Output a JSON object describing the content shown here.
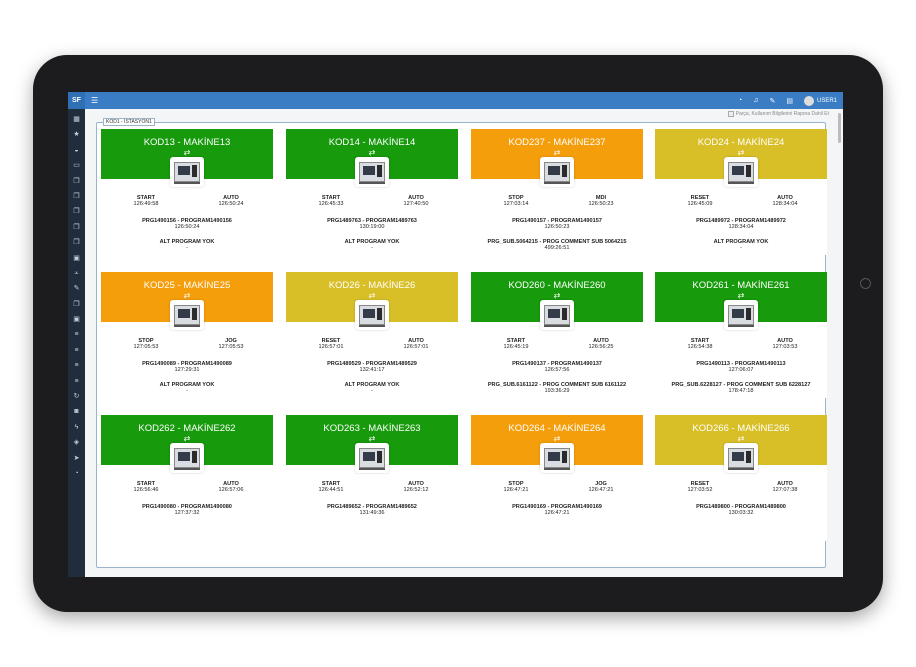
{
  "app": {
    "brand": "SF",
    "user": "USER1",
    "station_label": "KOD1 - İSTASYON1",
    "info_text": "Parça, Kullanım Bilgilerini Rapora Dahil Et"
  },
  "icons": {
    "menu": "hamburger-icon",
    "chat": "chat-icon",
    "bell": "bell-icon",
    "wrench": "wrench-icon",
    "file": "file-icon"
  },
  "colors": {
    "green": "#179a0c",
    "orange": "#f59e0b",
    "yellow": "#d8bf27",
    "topbar": "#3a7dc5",
    "sidebar": "#1f2d3d"
  },
  "cards": [
    {
      "title": "KOD13 - MAKİNE13",
      "color": "green",
      "arrow": "⇄",
      "s1": "START",
      "t1": "126:49:58",
      "s2": "AUTO",
      "t2": "126:50:24",
      "prg": "PRG1490156 - PROGRAM1490156",
      "prg_time": "126:50:24",
      "alt": "ALT PROGRAM YOK",
      "alt_time": "-"
    },
    {
      "title": "KOD14 - MAKİNE14",
      "color": "green",
      "arrow": "⇄",
      "s1": "START",
      "t1": "126:45:33",
      "s2": "AUTO",
      "t2": "127:40:50",
      "prg": "PRG1489763 - PROGRAM1489763",
      "prg_time": "130:19:00",
      "alt": "ALT PROGRAM YOK",
      "alt_time": "-"
    },
    {
      "title": "KOD237 - MAKİNE237",
      "color": "orange",
      "arrow": "⇄",
      "s1": "STOP",
      "t1": "127:03:14",
      "s2": "MDI",
      "t2": "126:50:23",
      "prg": "PRG1490157 - PROGRAM1490157",
      "prg_time": "126:50:23",
      "alt": "PRG_SUB.5064215 - PROG COMMENT SUB 5064215",
      "alt_time": "499:26:51"
    },
    {
      "title": "KOD24 - MAKİNE24",
      "color": "yellow",
      "arrow": "⇄",
      "s1": "RESET",
      "t1": "126:45:09",
      "s2": "AUTO",
      "t2": "128:34:04",
      "prg": "PRG1489972 - PROGRAM1489972",
      "prg_time": "128:34:04",
      "alt": "ALT PROGRAM YOK",
      "alt_time": "-"
    },
    {
      "title": "KOD25 - MAKİNE25",
      "color": "orange",
      "arrow": "⇄",
      "s1": "STOP",
      "t1": "127:05:53",
      "s2": "JOG",
      "t2": "127:05:53",
      "prg": "PRG1490089 - PROGRAM1490089",
      "prg_time": "127:29:31",
      "alt": "ALT PROGRAM YOK",
      "alt_time": "-"
    },
    {
      "title": "KOD26 - MAKİNE26",
      "color": "yellow",
      "arrow": "⇄",
      "s1": "RESET",
      "t1": "126:57:01",
      "s2": "AUTO",
      "t2": "126:57:01",
      "prg": "PRG1489529 - PROGRAM1489529",
      "prg_time": "132:41:17",
      "alt": "ALT PROGRAM YOK",
      "alt_time": "-"
    },
    {
      "title": "KOD260 - MAKİNE260",
      "color": "green",
      "arrow": "⇄",
      "s1": "START",
      "t1": "126:45:19",
      "s2": "AUTO",
      "t2": "126:56:25",
      "prg": "PRG1490137 - PROGRAM1490137",
      "prg_time": "126:57:56",
      "alt": "PRG_SUB.6161122 - PROG COMMENT SUB 6161122",
      "alt_time": "193:36:29"
    },
    {
      "title": "KOD261 - MAKİNE261",
      "color": "green",
      "arrow": "⇄",
      "s1": "START",
      "t1": "126:54:38",
      "s2": "AUTO",
      "t2": "127:03:53",
      "prg": "PRG1490113 - PROGRAM1490113",
      "prg_time": "127:06:07",
      "alt": "PRG_SUB.6228127 - PROG COMMENT SUB 6228127",
      "alt_time": "178:47:18"
    },
    {
      "title": "KOD262 - MAKİNE262",
      "color": "green",
      "arrow": "⇄",
      "s1": "START",
      "t1": "126:56:46",
      "s2": "AUTO",
      "t2": "126:57:06",
      "prg": "PRG1490080 - PROGRAM1490080",
      "prg_time": "127:37:32",
      "alt": "",
      "alt_time": ""
    },
    {
      "title": "KOD263 - MAKİNE263",
      "color": "green",
      "arrow": "⇄",
      "s1": "START",
      "t1": "126:44:51",
      "s2": "AUTO",
      "t2": "126:52:12",
      "prg": "PRG1489652 - PROGRAM1489652",
      "prg_time": "131:49:36",
      "alt": "",
      "alt_time": ""
    },
    {
      "title": "KOD264 - MAKİNE264",
      "color": "orange",
      "arrow": "⇄",
      "s1": "STOP",
      "t1": "126:47:21",
      "s2": "JOG",
      "t2": "126:47:21",
      "prg": "PRG1490169 - PROGRAM1490169",
      "prg_time": "126:47:21",
      "alt": "",
      "alt_time": ""
    },
    {
      "title": "KOD266 - MAKİNE266",
      "color": "yellow",
      "arrow": "⇄",
      "s1": "RESET",
      "t1": "127:03:52",
      "s2": "AUTO",
      "t2": "127:07:38",
      "prg": "PRG1489800 - PROGRAM1489800",
      "prg_time": "130:03:32",
      "alt": "",
      "alt_time": ""
    }
  ]
}
